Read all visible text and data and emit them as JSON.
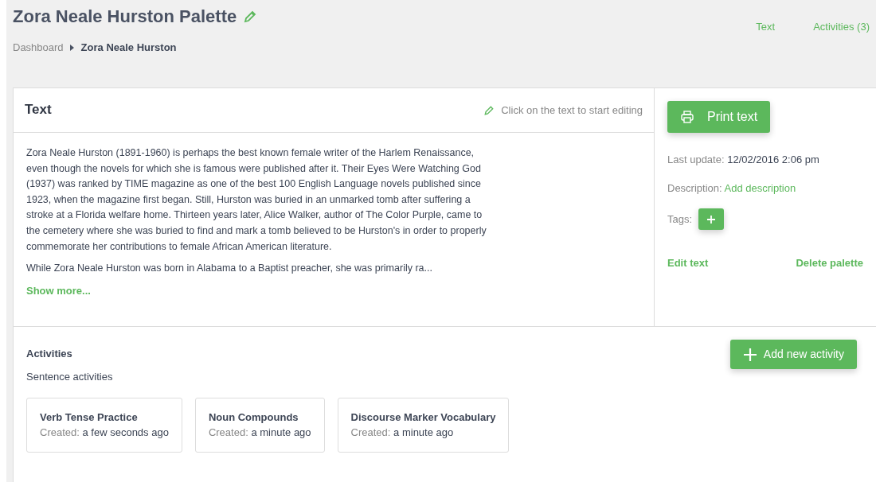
{
  "header": {
    "title": "Zora Neale Hurston Palette",
    "breadcrumb": [
      {
        "label": "Dashboard",
        "current": false
      },
      {
        "label": "Zora Neale Hurston",
        "current": true
      }
    ],
    "links": [
      "Text",
      "Activities (3)"
    ]
  },
  "text_panel": {
    "title": "Text",
    "hint": "Click on the text to start editing",
    "paragraphs": [
      "Zora Neale Hurston (1891-1960) is perhaps the best known female writer of the Harlem Renaissance, even though the novels for which she is famous were published after it. Their Eyes Were Watching God (1937) was ranked by TIME magazine as one of the best 100 English Language novels published since 1923, when the magazine first began. Still, Hurston was buried in an unmarked tomb after suffering a stroke at a Florida welfare home. Thirteen years later, Alice Walker, author of The Color Purple, came to the cemetery where she was buried to find and mark a tomb believed to be Hurston's in order to properly commemorate her contributions to female African American literature.",
      "While Zora Neale Hurston was born in Alabama to a Baptist preacher, she was primarily ra..."
    ],
    "show_more": "Show more..."
  },
  "side_panel": {
    "print_button": "Print text",
    "last_update_label": "Last update:",
    "last_update": "12/02/2016 2:06 pm",
    "description_label": "Description:",
    "description_link": "Add description",
    "tags_label": "Tags:",
    "edit_link": "Edit text",
    "delete_link": "Delete palette"
  },
  "activities": {
    "title": "Activities",
    "add_button": "Add new activity",
    "group_title": "Sentence activities",
    "items": [
      {
        "title": "Verb Tense Practice",
        "created_label": "Created:",
        "created": "a few seconds ago"
      },
      {
        "title": "Noun Compounds",
        "created_label": "Created:",
        "created": "a minute ago"
      },
      {
        "title": "Discourse Marker Vocabulary",
        "created_label": "Created:",
        "created": "a minute ago"
      }
    ]
  }
}
